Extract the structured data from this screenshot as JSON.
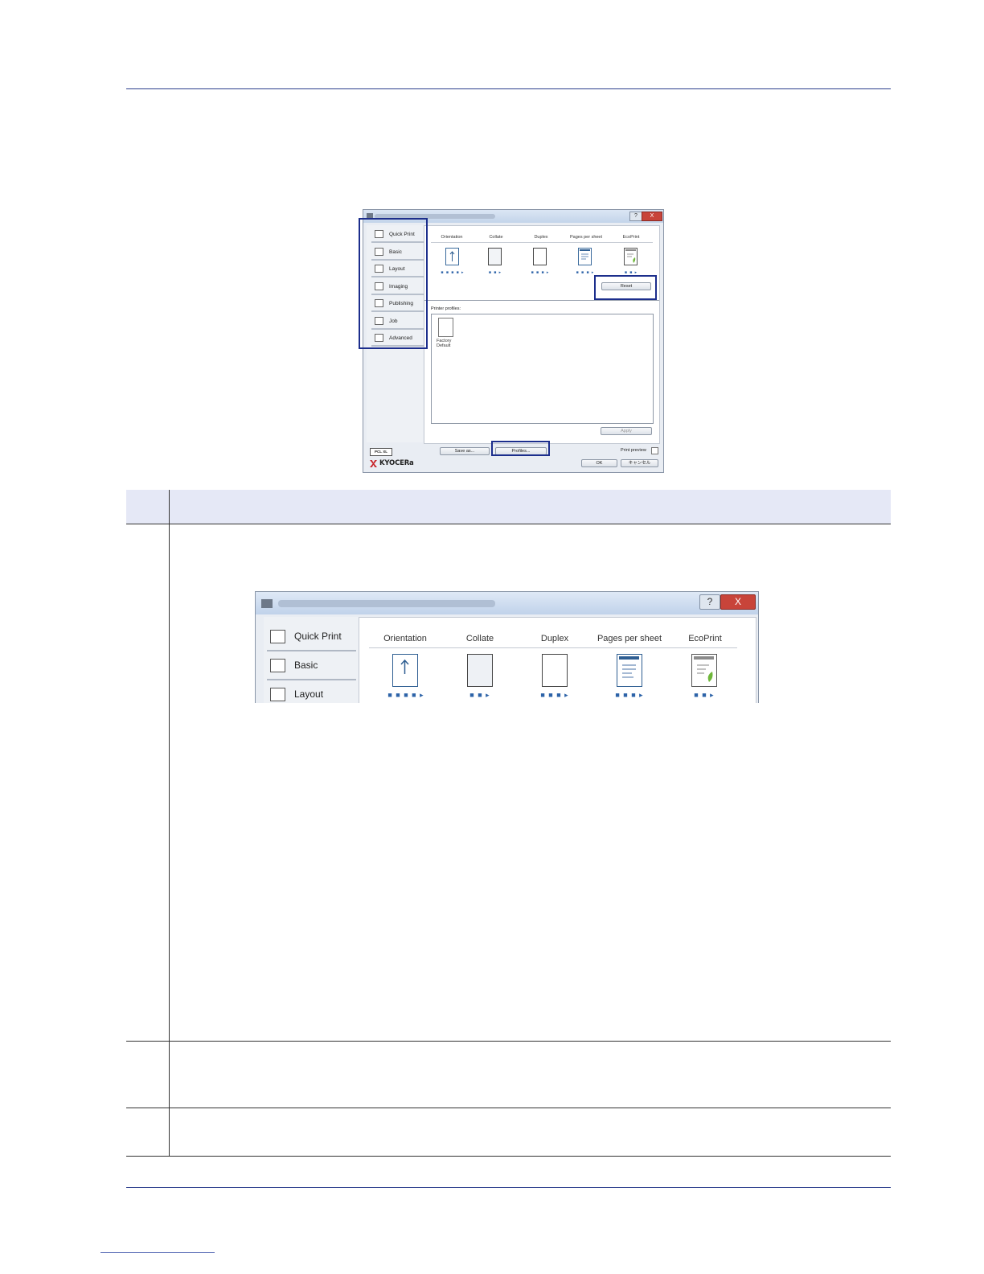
{
  "dialog": {
    "help_glyph": "?",
    "close_glyph": "X",
    "tabs": [
      {
        "label": "Quick Print",
        "icon": "quick-print-icon"
      },
      {
        "label": "Basic",
        "icon": "basic-icon"
      },
      {
        "label": "Layout",
        "icon": "layout-icon"
      },
      {
        "label": "Imaging",
        "icon": "imaging-icon"
      },
      {
        "label": "Publishing",
        "icon": "publishing-icon"
      },
      {
        "label": "Job",
        "icon": "job-icon"
      },
      {
        "label": "Advanced",
        "icon": "advanced-icon"
      }
    ],
    "columns": [
      "Orientation",
      "Collate",
      "Duplex",
      "Pages per sheet",
      "EcoPrint"
    ],
    "column_dots": [
      "■ ■ ■ ■ ▸",
      "■ ■ ▸",
      "■ ■ ■ ▸",
      "■ ■ ■ ▸",
      "■ ■ ▸"
    ],
    "reset_label": "Reset",
    "printer_profiles_label": "Printer profiles:",
    "profile_item": "Factory Default",
    "apply_label": "Apply",
    "pdl_badge": "PCL XL",
    "save_as_label": "Save as...",
    "profiles_label": "Profiles...",
    "print_preview_label": "Print preview",
    "ok_label": "OK",
    "cancel_label": "キャンセル",
    "brand": "KYOCERa"
  },
  "zoomed_dialog": {
    "help_glyph": "?",
    "close_glyph": "X",
    "tabs": [
      {
        "label": "Quick Print"
      },
      {
        "label": "Basic"
      },
      {
        "label": "Layout"
      }
    ],
    "columns": [
      "Orientation",
      "Collate",
      "Duplex",
      "Pages per sheet",
      "EcoPrint"
    ],
    "column_dots": [
      "■ ■ ■ ■ ▸",
      "■ ■ ▸",
      "■ ■ ■ ▸",
      "■ ■ ■ ▸",
      "■ ■ ▸"
    ]
  },
  "colors": {
    "rule": "#2c3e8c",
    "highlight_box": "#1c2e8c",
    "table_header": "#e5e8f6"
  }
}
